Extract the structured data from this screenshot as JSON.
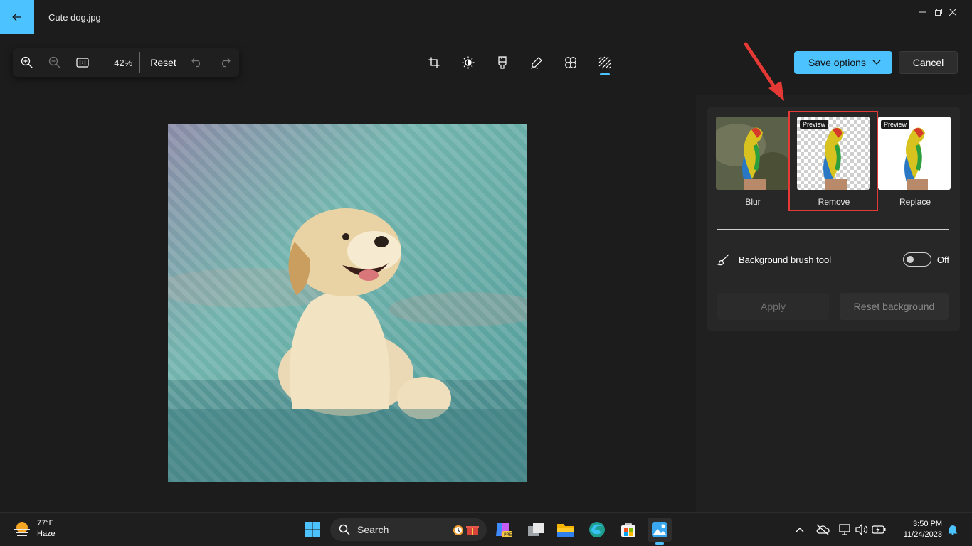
{
  "window": {
    "title": "Cute dog.jpg"
  },
  "zoom_toolbar": {
    "zoom_level": "42%",
    "reset_label": "Reset"
  },
  "header": {
    "save_label": "Save options",
    "cancel_label": "Cancel"
  },
  "background_panel": {
    "options": [
      {
        "label": "Blur",
        "preview_tag": ""
      },
      {
        "label": "Remove",
        "preview_tag": "Preview"
      },
      {
        "label": "Replace",
        "preview_tag": "Preview"
      }
    ],
    "selected": "Remove",
    "brush_tool_label": "Background brush tool",
    "brush_tool_state": "Off",
    "apply_label": "Apply",
    "reset_background_label": "Reset background"
  },
  "taskbar": {
    "weather": {
      "temperature": "77°F",
      "condition": "Haze"
    },
    "search_label": "Search",
    "clock": {
      "time": "3:50 PM",
      "date": "11/24/2023"
    }
  },
  "colors": {
    "accent": "#4cc2ff",
    "highlight": "#e53935"
  }
}
